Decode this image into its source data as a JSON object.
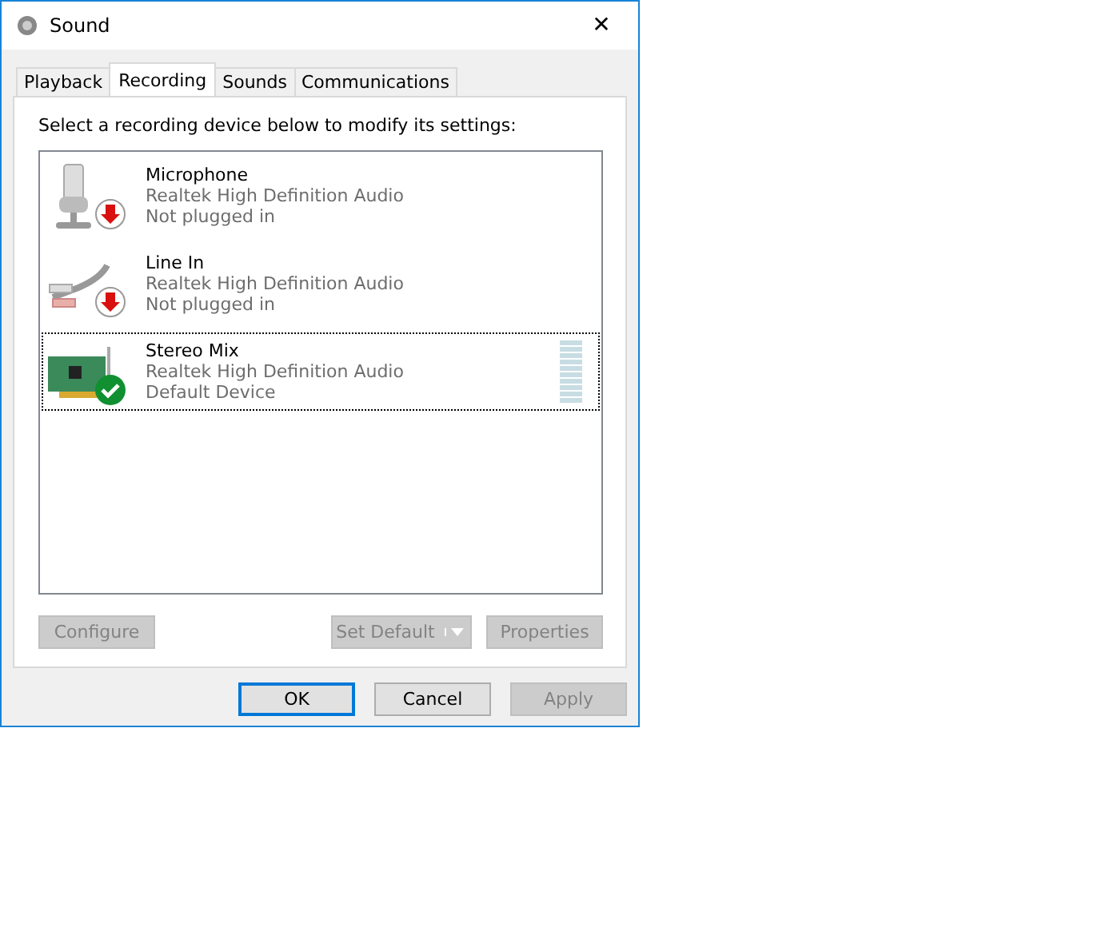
{
  "window": {
    "title": "Sound",
    "close": "✕"
  },
  "tabs": [
    {
      "label": "Playback",
      "selected": false
    },
    {
      "label": "Recording",
      "selected": true
    },
    {
      "label": "Sounds",
      "selected": false
    },
    {
      "label": "Communications",
      "selected": false
    }
  ],
  "instruction": "Select a recording device below to modify its settings:",
  "devices": [
    {
      "kind": "microphone",
      "default": false,
      "name": "Microphone",
      "driver": "Realtek High Definition Audio",
      "state": "Not plugged in",
      "selected": false
    },
    {
      "kind": "line-in",
      "default": false,
      "name": "Line In",
      "driver": "Realtek High Definition Audio",
      "state": "Not plugged in",
      "selected": false
    },
    {
      "kind": "card",
      "default": true,
      "name": "Stereo Mix",
      "driver": "Realtek High Definition Audio",
      "state": "Default Device",
      "selected": true,
      "level": 0
    }
  ],
  "device_buttons": [
    {
      "kind": "button",
      "label": "Configure",
      "disabled": true
    },
    {
      "kind": "split",
      "label": "Set Default",
      "disabled": true
    },
    {
      "kind": "button",
      "label": "Properties",
      "disabled": true
    }
  ],
  "dialog_buttons": [
    {
      "label": "OK",
      "disabled": false,
      "default": true
    },
    {
      "label": "Cancel",
      "disabled": false,
      "default": false
    },
    {
      "label": "Apply",
      "disabled": true,
      "default": false
    }
  ]
}
